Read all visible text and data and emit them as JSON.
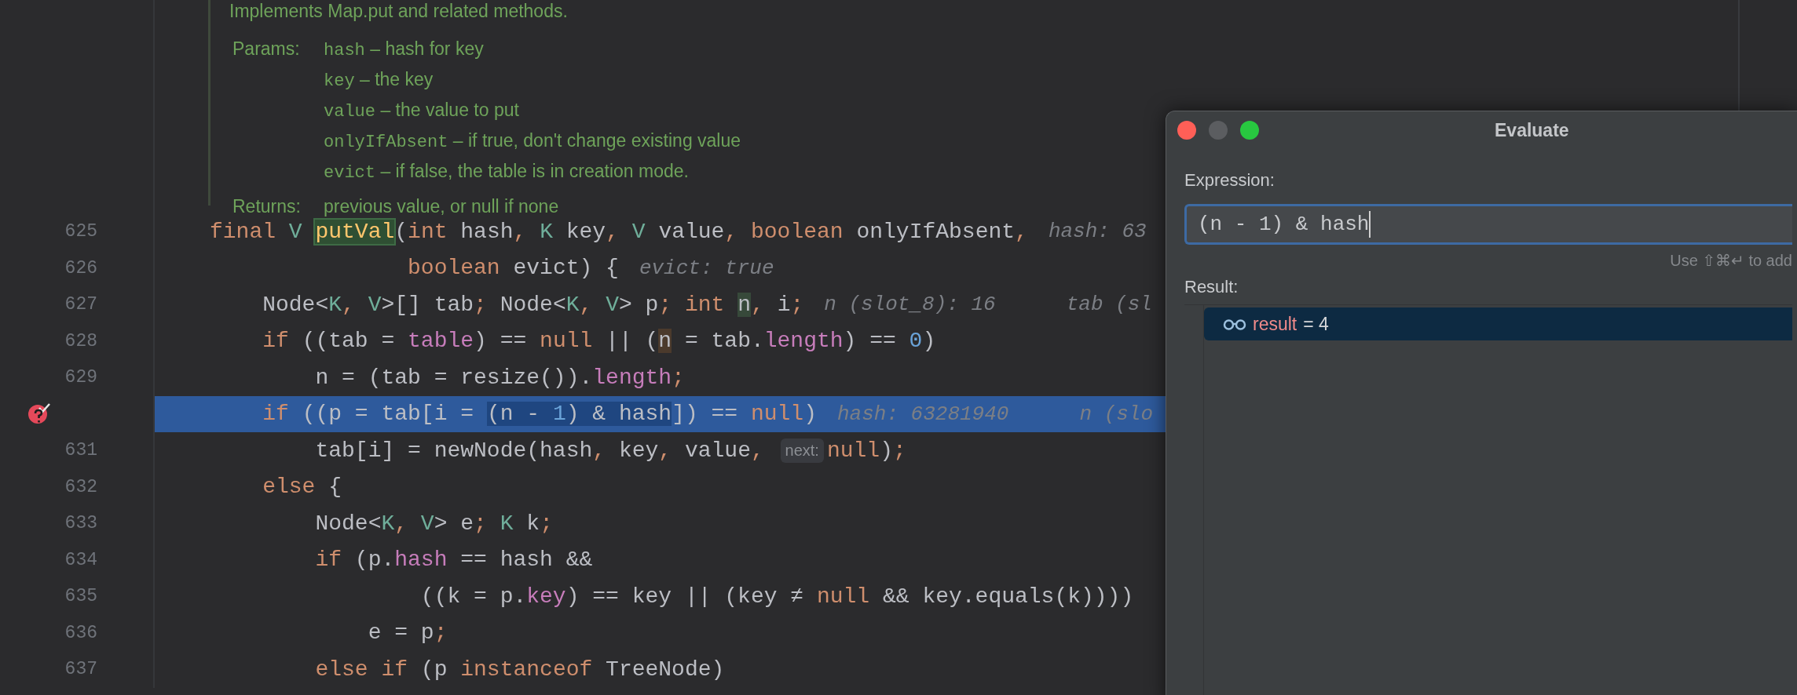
{
  "doc": {
    "summary": "Implements Map.put and related methods.",
    "params_label": "Params:",
    "params": [
      {
        "name": "hash",
        "desc": " – hash for key"
      },
      {
        "name": "key",
        "desc": " – the key"
      },
      {
        "name": "value",
        "desc": " – the value to put"
      },
      {
        "name": "onlyIfAbsent",
        "desc": " – if true, don't change existing value"
      },
      {
        "name": "evict",
        "desc": " – if false, the table is in creation mode."
      }
    ],
    "returns_label": "Returns:",
    "returns": "previous value, or null if none"
  },
  "lines": [
    {
      "number": "625",
      "breakpoint": false,
      "current": false,
      "tokens": [
        {
          "kind": "keyword",
          "t": "final "
        },
        {
          "kind": "type",
          "t": "V "
        },
        {
          "kind": "decl",
          "t": "putVal"
        },
        {
          "kind": "plain",
          "t": "("
        },
        {
          "kind": "keyword",
          "t": "int "
        },
        {
          "kind": "plain",
          "t": "hash"
        },
        {
          "kind": "keyword",
          "t": ", "
        },
        {
          "kind": "type",
          "t": "K "
        },
        {
          "kind": "plain",
          "t": "key"
        },
        {
          "kind": "keyword",
          "t": ", "
        },
        {
          "kind": "type",
          "t": "V "
        },
        {
          "kind": "plain",
          "t": "value"
        },
        {
          "kind": "keyword",
          "t": ", boolean "
        },
        {
          "kind": "plain",
          "t": "onlyIfAbsent"
        },
        {
          "kind": "keyword",
          "t": ","
        },
        {
          "kind": "hint",
          "t": "hash: 63"
        }
      ]
    },
    {
      "number": "626",
      "breakpoint": false,
      "current": false,
      "tokens": [
        {
          "kind": "keyword",
          "t": "               boolean "
        },
        {
          "kind": "plain",
          "t": "evict) {"
        },
        {
          "kind": "hint",
          "t": "evict: true"
        }
      ]
    },
    {
      "number": "627",
      "breakpoint": false,
      "current": false,
      "tokens": [
        {
          "kind": "plain",
          "t": "    Node<"
        },
        {
          "kind": "type",
          "t": "K"
        },
        {
          "kind": "keyword",
          "t": ", "
        },
        {
          "kind": "type",
          "t": "V"
        },
        {
          "kind": "plain",
          "t": ">[] tab"
        },
        {
          "kind": "keyword",
          "t": "; "
        },
        {
          "kind": "plain",
          "t": "Node<"
        },
        {
          "kind": "type",
          "t": "K"
        },
        {
          "kind": "keyword",
          "t": ", "
        },
        {
          "kind": "type",
          "t": "V"
        },
        {
          "kind": "plain",
          "t": "> p"
        },
        {
          "kind": "keyword",
          "t": "; int "
        },
        {
          "kind": "write",
          "t": "n"
        },
        {
          "kind": "keyword",
          "t": ", "
        },
        {
          "kind": "plain",
          "t": "i"
        },
        {
          "kind": "keyword",
          "t": ";"
        },
        {
          "kind": "hint",
          "t": "n (slot_8): 16"
        },
        {
          "kind": "hint",
          "t": "tab (sl"
        }
      ]
    },
    {
      "number": "628",
      "breakpoint": false,
      "current": false,
      "tokens": [
        {
          "kind": "keyword",
          "t": "    if "
        },
        {
          "kind": "plain",
          "t": "((tab = "
        },
        {
          "kind": "field",
          "t": "table"
        },
        {
          "kind": "plain",
          "t": ") == "
        },
        {
          "kind": "keyword",
          "t": "null "
        },
        {
          "kind": "plain",
          "t": "|| ("
        },
        {
          "kind": "read",
          "t": "n"
        },
        {
          "kind": "plain",
          "t": " = tab."
        },
        {
          "kind": "field",
          "t": "length"
        },
        {
          "kind": "plain",
          "t": ") == "
        },
        {
          "kind": "number",
          "t": "0"
        },
        {
          "kind": "plain",
          "t": ")"
        }
      ]
    },
    {
      "number": "629",
      "breakpoint": false,
      "current": false,
      "tokens": [
        {
          "kind": "plain",
          "t": "        n = (tab = resize())."
        },
        {
          "kind": "field",
          "t": "length"
        },
        {
          "kind": "keyword",
          "t": ";"
        }
      ]
    },
    {
      "breakpoint": true,
      "current": true,
      "tokens": [
        {
          "kind": "keyword",
          "t": "    if "
        },
        {
          "kind": "plain",
          "t": "((p = tab[i = "
        },
        {
          "kind": "selection",
          "parts": [
            {
              "kind": "plain",
              "t": "(n - "
            },
            {
              "kind": "number",
              "t": "1"
            },
            {
              "kind": "plain",
              "t": ") & hash"
            }
          ]
        },
        {
          "kind": "plain",
          "t": "]) == "
        },
        {
          "kind": "keyword",
          "t": "null"
        },
        {
          "kind": "plain",
          "t": ")"
        },
        {
          "kind": "hint",
          "t": "hash: 63281940"
        },
        {
          "kind": "hint",
          "t": "n (slo"
        }
      ]
    },
    {
      "number": "631",
      "breakpoint": false,
      "current": false,
      "tokens": [
        {
          "kind": "plain",
          "t": "        tab[i] = newNode(hash"
        },
        {
          "kind": "keyword",
          "t": ", "
        },
        {
          "kind": "plain",
          "t": "key"
        },
        {
          "kind": "keyword",
          "t": ", "
        },
        {
          "kind": "plain",
          "t": "value"
        },
        {
          "kind": "keyword",
          "t": ", "
        },
        {
          "kind": "badge",
          "t": "next:"
        },
        {
          "kind": "keyword",
          "t": "null"
        },
        {
          "kind": "plain",
          "t": ")"
        },
        {
          "kind": "keyword",
          "t": ";"
        }
      ]
    },
    {
      "number": "632",
      "breakpoint": false,
      "current": false,
      "tokens": [
        {
          "kind": "keyword",
          "t": "    else "
        },
        {
          "kind": "plain",
          "t": "{"
        }
      ]
    },
    {
      "number": "633",
      "breakpoint": false,
      "current": false,
      "tokens": [
        {
          "kind": "plain",
          "t": "        Node<"
        },
        {
          "kind": "type",
          "t": "K"
        },
        {
          "kind": "keyword",
          "t": ", "
        },
        {
          "kind": "type",
          "t": "V"
        },
        {
          "kind": "plain",
          "t": "> e"
        },
        {
          "kind": "keyword",
          "t": "; "
        },
        {
          "kind": "type",
          "t": "K "
        },
        {
          "kind": "plain",
          "t": "k"
        },
        {
          "kind": "keyword",
          "t": ";"
        }
      ]
    },
    {
      "number": "634",
      "breakpoint": false,
      "current": false,
      "tokens": [
        {
          "kind": "keyword",
          "t": "        if "
        },
        {
          "kind": "plain",
          "t": "(p."
        },
        {
          "kind": "field",
          "t": "hash"
        },
        {
          "kind": "plain",
          "t": " == hash &&"
        }
      ]
    },
    {
      "number": "635",
      "breakpoint": false,
      "current": false,
      "tokens": [
        {
          "kind": "plain",
          "t": "                ((k = p."
        },
        {
          "kind": "field",
          "t": "key"
        },
        {
          "kind": "plain",
          "t": ") == key || (key ≠ "
        },
        {
          "kind": "keyword",
          "t": "null "
        },
        {
          "kind": "plain",
          "t": "&& key.equals(k)))"
        },
        {
          "kind": "plain",
          "t": ")"
        }
      ]
    },
    {
      "number": "636",
      "breakpoint": false,
      "current": false,
      "tokens": [
        {
          "kind": "plain",
          "t": "            e = p"
        },
        {
          "kind": "keyword",
          "t": ";"
        }
      ]
    },
    {
      "number": "637",
      "breakpoint": false,
      "current": false,
      "tokens": [
        {
          "kind": "keyword",
          "t": "        else if "
        },
        {
          "kind": "plain",
          "t": "(p "
        },
        {
          "kind": "keyword",
          "t": "instanceof "
        },
        {
          "kind": "plain",
          "t": "TreeNode)"
        }
      ]
    }
  ],
  "dialog": {
    "title": "Evaluate",
    "window_buttons": [
      {
        "kind": "close",
        "disabled": false
      },
      {
        "kind": "minimize",
        "disabled": true
      },
      {
        "kind": "zoom",
        "disabled": false
      }
    ],
    "expression_label": "Expression:",
    "expression": "(n - 1) & hash",
    "hint": "Use ⇧⌘↵ to add",
    "result_label": "Result:",
    "results": [
      {
        "name": "result",
        "value": "= 4",
        "selected": true
      }
    ]
  }
}
